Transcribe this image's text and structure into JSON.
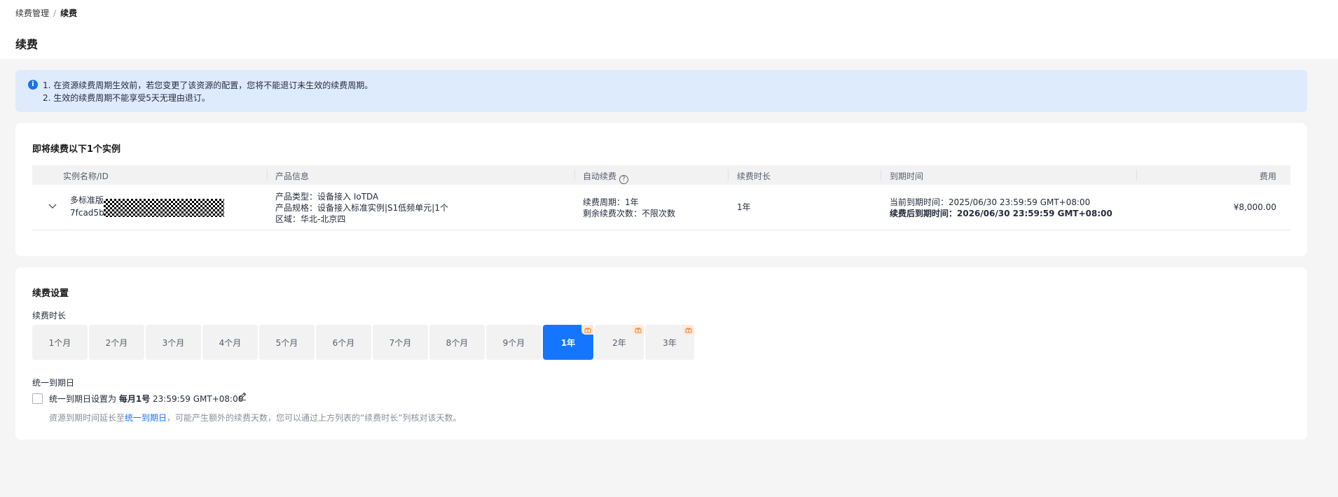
{
  "breadcrumb": {
    "parent": "续费管理",
    "separator": "/",
    "current": "续费"
  },
  "page_title": "续费",
  "notice": {
    "line1": "1. 在资源续费周期生效前，若您变更了该资源的配置，您将不能退订未生效的续费周期。",
    "line2": "2. 生效的续费周期不能享受5天无理由退订。"
  },
  "instances": {
    "title": "即将续费以下1个实例",
    "columns": [
      "实例名称/ID",
      "产品信息",
      "自动续费",
      "续费时长",
      "到期时间",
      "费用"
    ],
    "rows": [
      {
        "name": "多标准版",
        "id": "7fcad5be",
        "product_type": "产品类型：设备接入 IoTDA",
        "product_spec": "产品规格：设备接入标准实例|S1低频单元|1个",
        "region": "区域：华北-北京四",
        "renew_cycle": "续费周期：1年",
        "renew_remaining": "剩余续费次数：不限次数",
        "duration": "1年",
        "current_expiry": "当前到期时间：2025/06/30 23:59:59 GMT+08:00",
        "renewed_expiry": "续费后到期时间：2026/06/30 23:59:59 GMT+08:00",
        "fee": "¥8,000.00"
      }
    ]
  },
  "settings": {
    "title": "续费设置",
    "duration_label": "续费时长",
    "durations": [
      "1个月",
      "2个月",
      "3个月",
      "4个月",
      "5个月",
      "6个月",
      "7个月",
      "8个月",
      "9个月",
      "1年",
      "2年",
      "3年"
    ],
    "selected_duration": "1年",
    "unify_label": "统一到期日",
    "unify_text_prefix": "统一到期日设置为",
    "unify_day": "每月1号",
    "unify_time": "23:59:59 GMT+08:00",
    "unify_hint_prefix": "资源到期时间延长至",
    "unify_hint_link": "统一到期日",
    "unify_hint_suffix": "，可能产生额外的续费天数，您可以通过上方列表的“续费时长”列核对该天数。"
  },
  "colors": {
    "accent": "#1476ff",
    "notice_bg": "#deebfd",
    "gift_bg": "#fde9d8"
  }
}
